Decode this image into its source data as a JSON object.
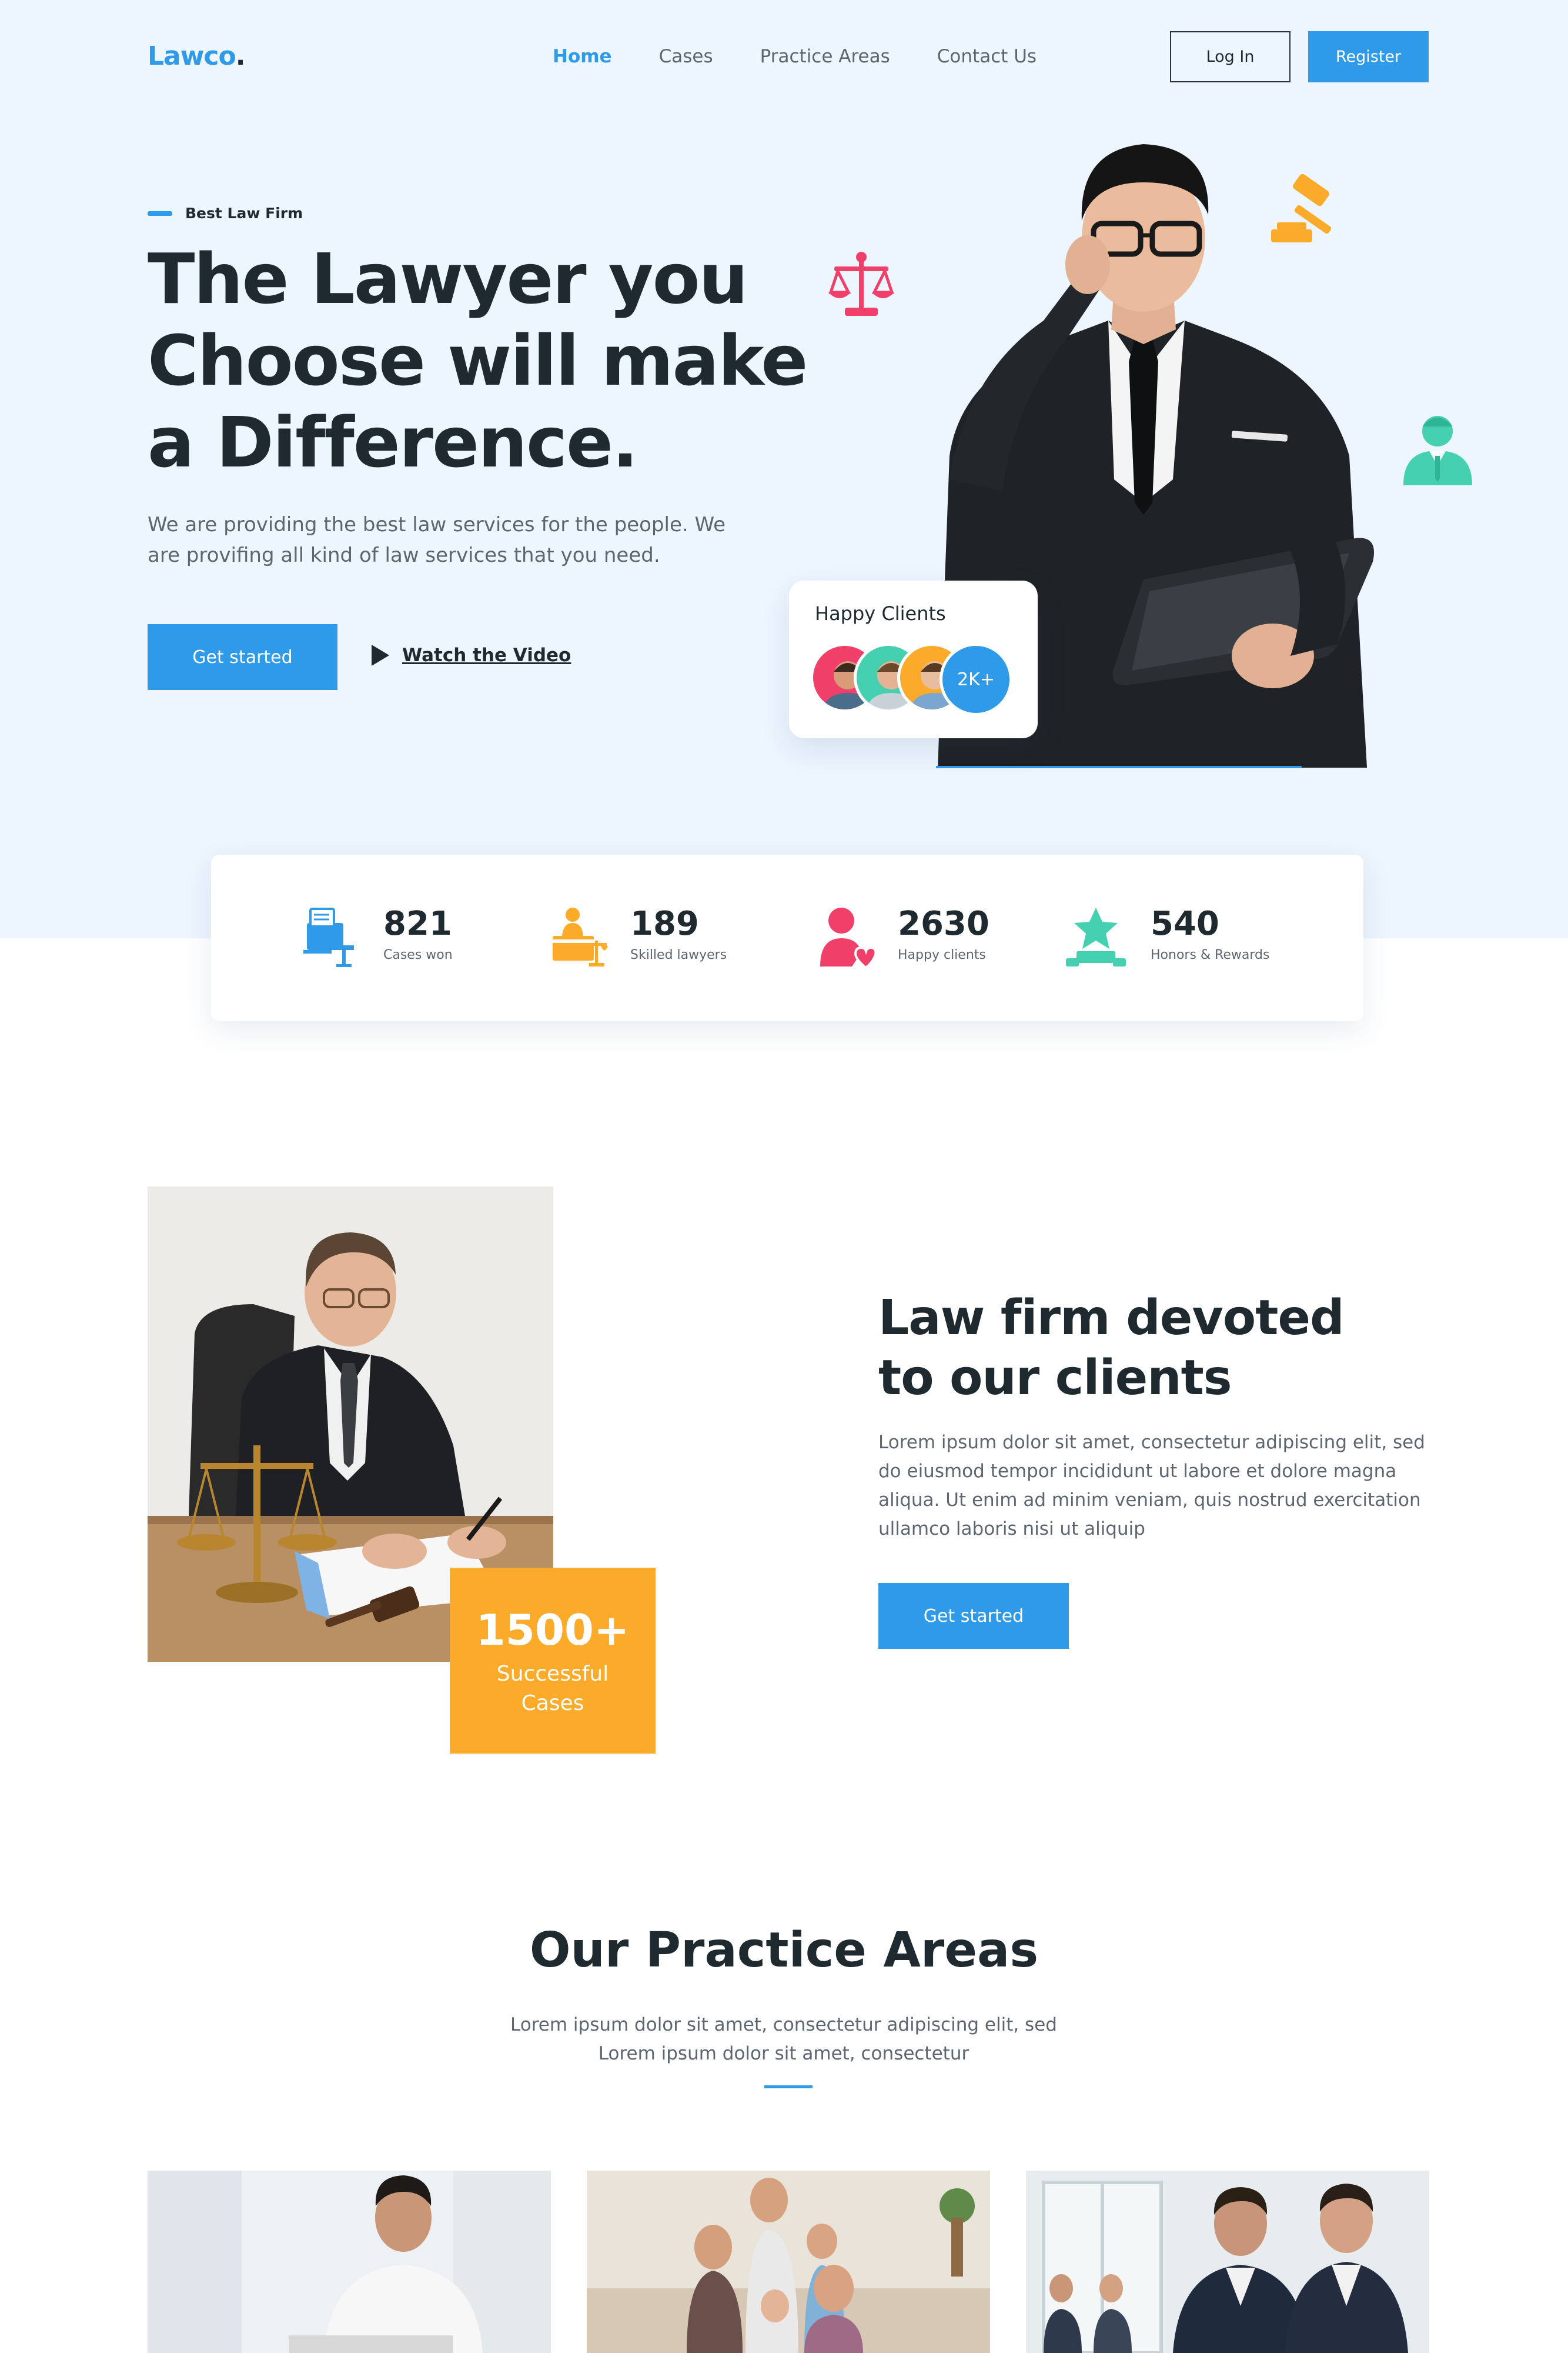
{
  "nav": {
    "logo": "Lawco",
    "logo_dot": ".",
    "links": [
      "Home",
      "Cases",
      "Practice Areas",
      "Contact Us"
    ],
    "login_label": "Log In",
    "register_label": "Register"
  },
  "hero": {
    "eyebrow": "Best Law Firm",
    "title_line1": "The Lawyer you",
    "title_line2": "Choose will make",
    "title_line3": "a Difference.",
    "text": "We are providing the best law services for the people. We are provifing all kind of law services that you need.",
    "cta_label": "Get started",
    "video_label": "Watch the Video",
    "clients_title": "Happy Clients",
    "clients_badge": "2K+"
  },
  "stats": [
    {
      "value": "821",
      "label": "Cases won",
      "icon": "cases-won-icon"
    },
    {
      "value": "189",
      "label": "Skilled lawyers",
      "icon": "lawyers-icon"
    },
    {
      "value": "2630",
      "label": "Happy clients",
      "icon": "happy-clients-icon"
    },
    {
      "value": "540",
      "label": "Honors & Rewards",
      "icon": "honors-icon"
    }
  ],
  "about": {
    "badge_number": "1500+",
    "badge_line1": "Successful",
    "badge_line2": "Cases",
    "title_line1": "Law firm devoted",
    "title_line2": "to our clients",
    "text": "Lorem ipsum dolor sit amet, consectetur adipiscing elit, sed do eiusmod tempor incididunt ut labore et dolore magna aliqua. Ut enim ad minim veniam, quis nostrud exercitation ullamco laboris nisi ut aliquip",
    "cta_label": "Get started"
  },
  "practice": {
    "title": "Our Practice Areas",
    "text_line1": "Lorem ipsum dolor sit amet, consectetur adipiscing elit, sed",
    "text_line2": "Lorem ipsum dolor sit amet, consectetur"
  },
  "colors": {
    "accent": "#2f9be8",
    "dark": "#1f2a30",
    "orange": "#fcaa2a",
    "red": "#f0406a",
    "teal": "#45d0b0",
    "hero_bg": "#edf5fe"
  }
}
